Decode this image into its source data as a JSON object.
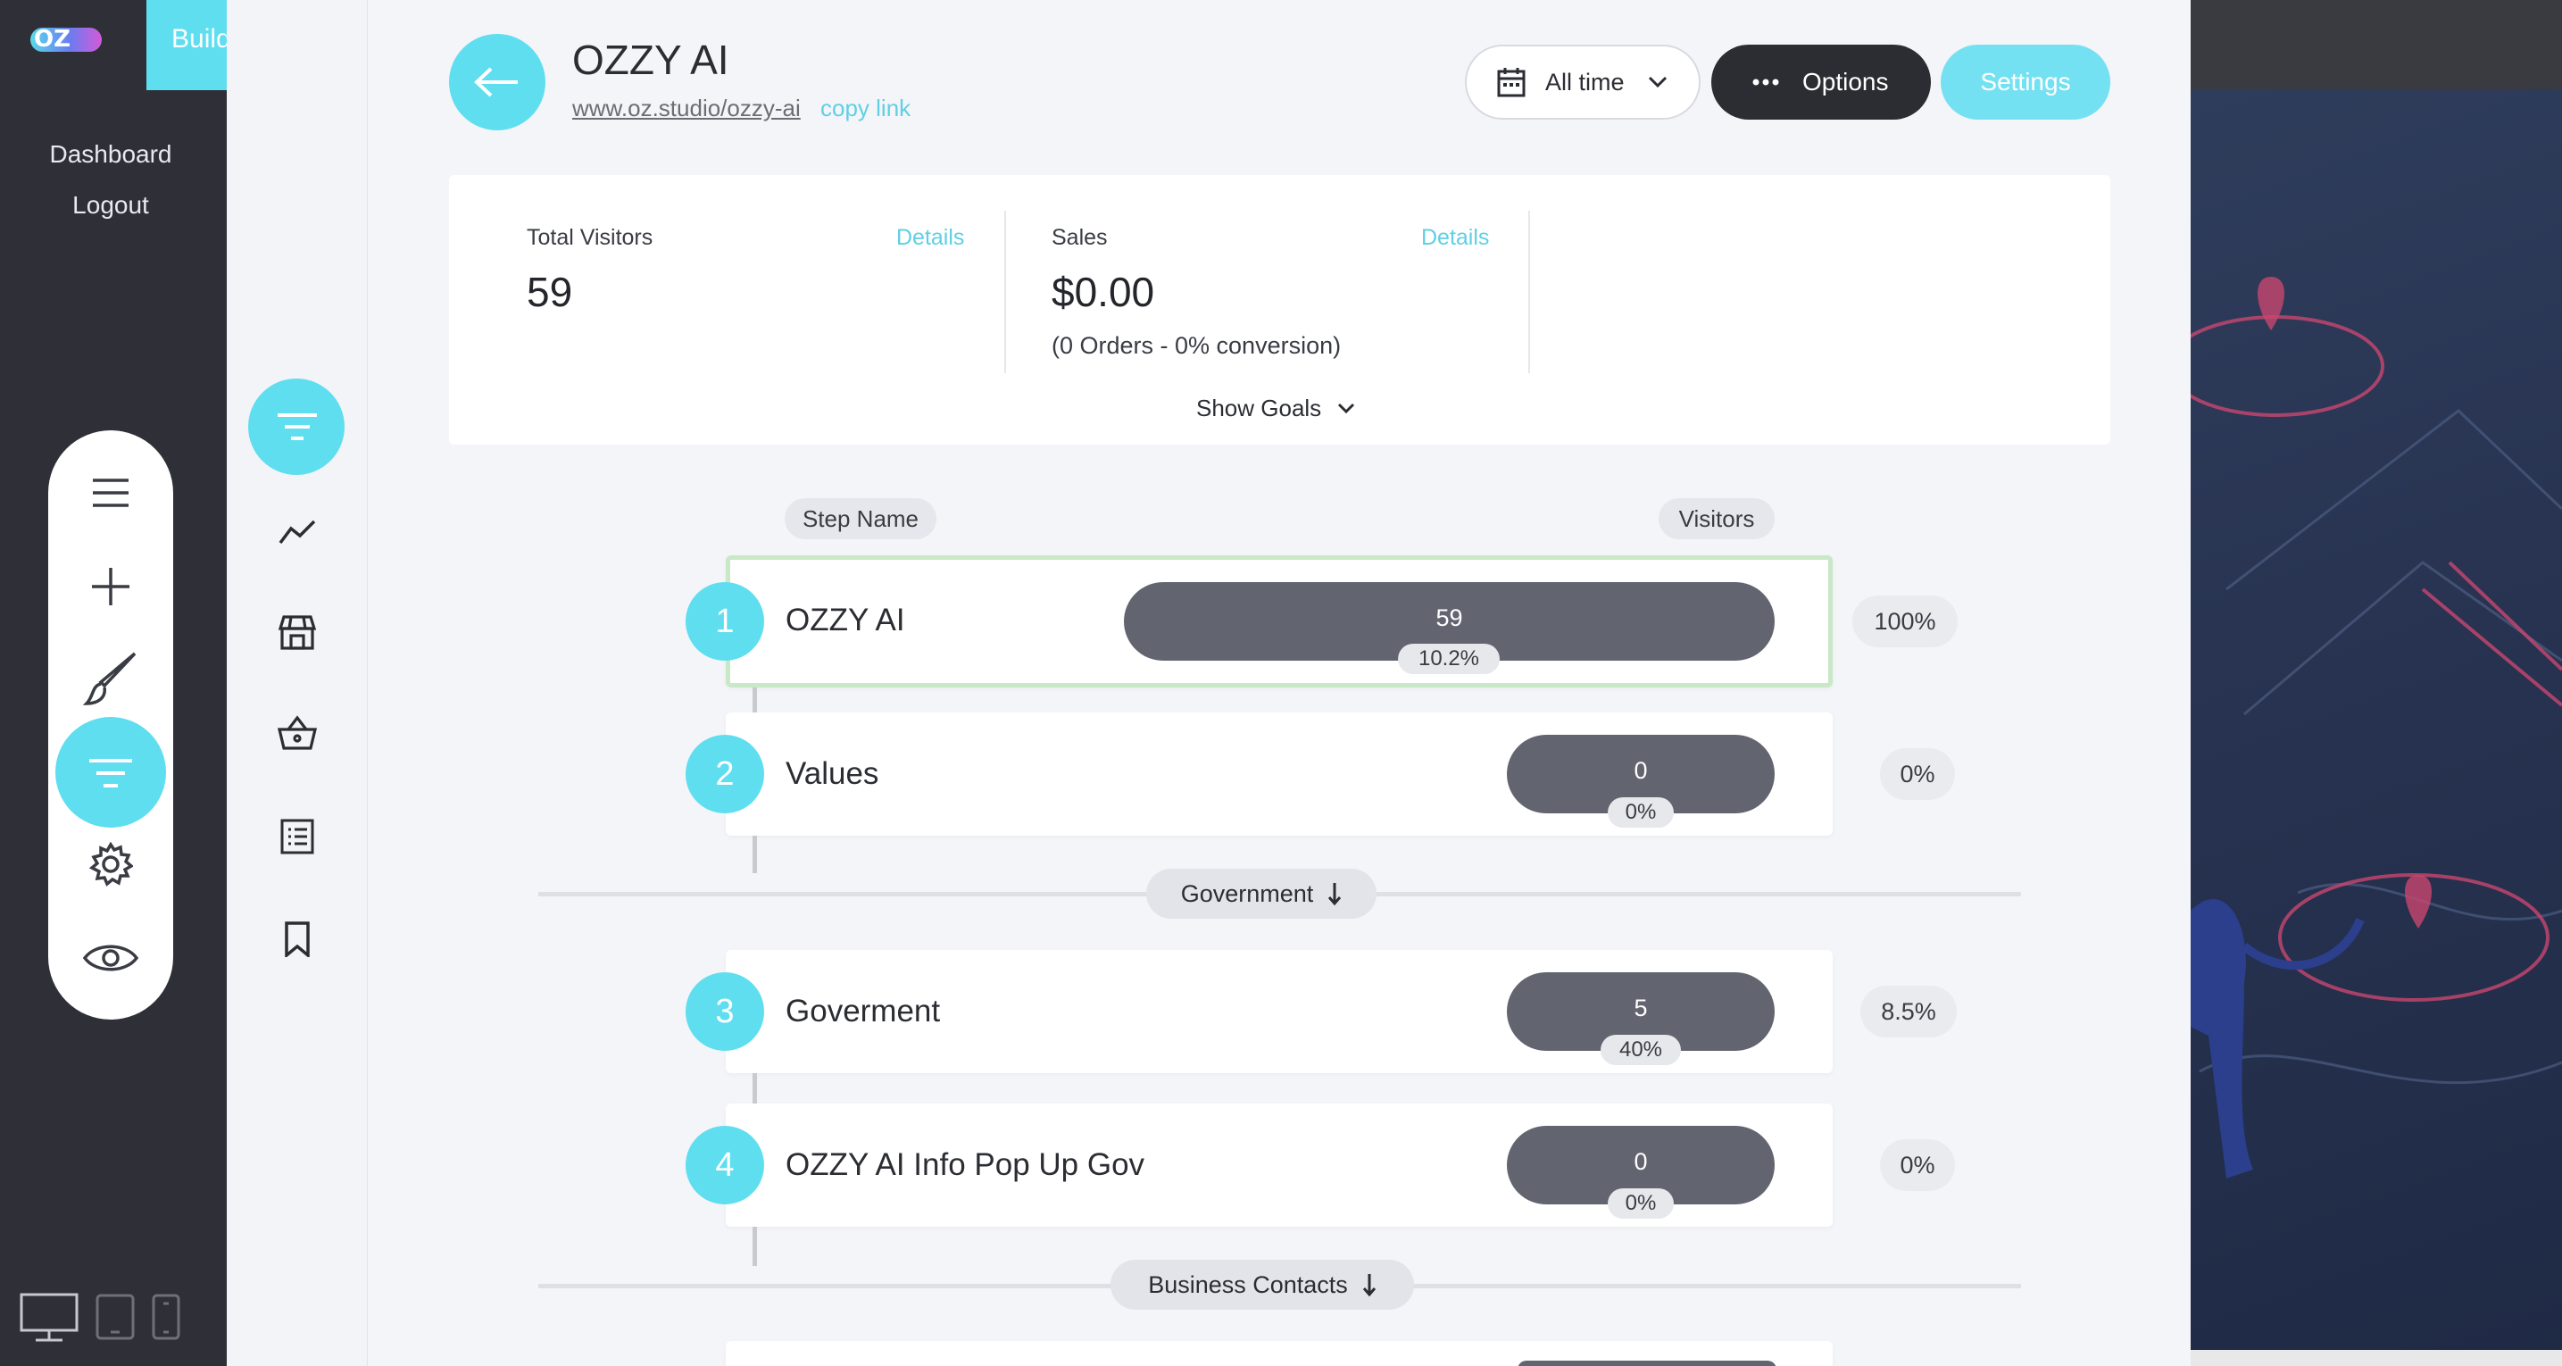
{
  "app": {
    "logo_text": "OZ",
    "build_label": "Build"
  },
  "left_nav": {
    "dashboard": "Dashboard",
    "logout": "Logout"
  },
  "tools": [
    "menu-icon",
    "plus-icon",
    "brush-icon",
    "funnel-icon",
    "gear-icon",
    "eye-icon"
  ],
  "devices": [
    "desktop-icon",
    "tablet-icon",
    "phone-icon"
  ],
  "secondary_nav": [
    "funnel-icon",
    "trend-icon",
    "store-icon",
    "basket-icon",
    "list-icon",
    "bookmark-icon"
  ],
  "header": {
    "title": "OZZY AI",
    "url": "www.oz.studio/ozzy-ai",
    "copy_link": "copy link",
    "date_filter": "All time",
    "options": "Options",
    "settings": "Settings"
  },
  "stats": {
    "visitors_label": "Total Visitors",
    "visitors_details": "Details",
    "visitors_value": "59",
    "sales_label": "Sales",
    "sales_details": "Details",
    "sales_value": "$0.00",
    "sales_sub": "(0 Orders - 0% conversion)",
    "show_goals": "Show Goals"
  },
  "columns": {
    "step_name": "Step Name",
    "visitors": "Visitors"
  },
  "steps": [
    {
      "num": "1",
      "name": "OZZY AI",
      "visitors": "59",
      "bar_pct": "10.2%",
      "pct": "100%"
    },
    {
      "num": "2",
      "name": "Values",
      "visitors": "0",
      "bar_pct": "0%",
      "pct": "0%"
    },
    {
      "num": "3",
      "name": "Goverment",
      "visitors": "5",
      "bar_pct": "40%",
      "pct": "8.5%"
    },
    {
      "num": "4",
      "name": "OZZY AI Info Pop Up Gov",
      "visitors": "0",
      "bar_pct": "0%",
      "pct": "0%"
    }
  ],
  "dividers": [
    "Government",
    "Business Contacts"
  ],
  "colors": {
    "accent": "#5fdef0",
    "dark": "#2c2d33",
    "bar": "#62646f",
    "selected_border": "#c9e8c7"
  }
}
